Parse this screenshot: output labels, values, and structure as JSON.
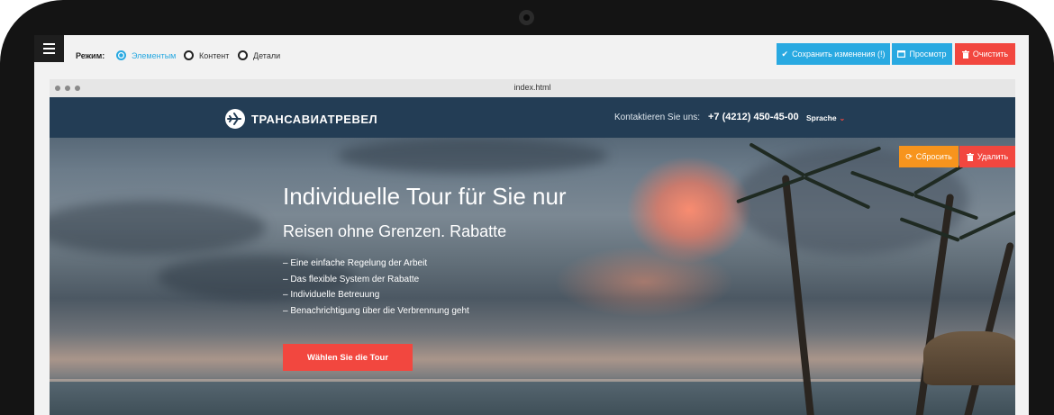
{
  "toolbar": {
    "mode_label": "Режим:",
    "modes": [
      {
        "label": "Элементым",
        "active": true
      },
      {
        "label": "Контент",
        "active": false
      },
      {
        "label": "Детали",
        "active": false
      }
    ],
    "save_label": "Сохранить изменения (!)",
    "preview_label": "Просмотр",
    "clear_label": "Очистить"
  },
  "browser": {
    "title": "index.html"
  },
  "site": {
    "logo": "ТРАНСАВИАТРЕВЕЛ",
    "contact_label": "Kontaktieren Sie uns:",
    "phone": "+7 (4212) 450-45-00",
    "language": "Sprache"
  },
  "hero": {
    "reset_label": "Сбросить",
    "delete_label": "Удалить",
    "title": "Individuelle Tour für Sie nur",
    "subtitle": "Reisen ohne Grenzen. Rabatte",
    "features": [
      "– Eine einfache Regelung der Arbeit",
      "– Das flexible System der Rabatte",
      "– Individuelle Betreuung",
      "– Benachrichtigung über die Verbrennung geht"
    ],
    "cta_label": "Wählen Sie die Tour"
  },
  "colors": {
    "accent_blue": "#29a9e1",
    "accent_red": "#f2473f",
    "accent_orange": "#f7941d",
    "header_navy": "#233d55"
  },
  "icons": [
    "menu-icon",
    "check-icon",
    "window-icon",
    "trash-icon",
    "refresh-icon",
    "plane-logo-icon",
    "chevron-down-icon"
  ]
}
